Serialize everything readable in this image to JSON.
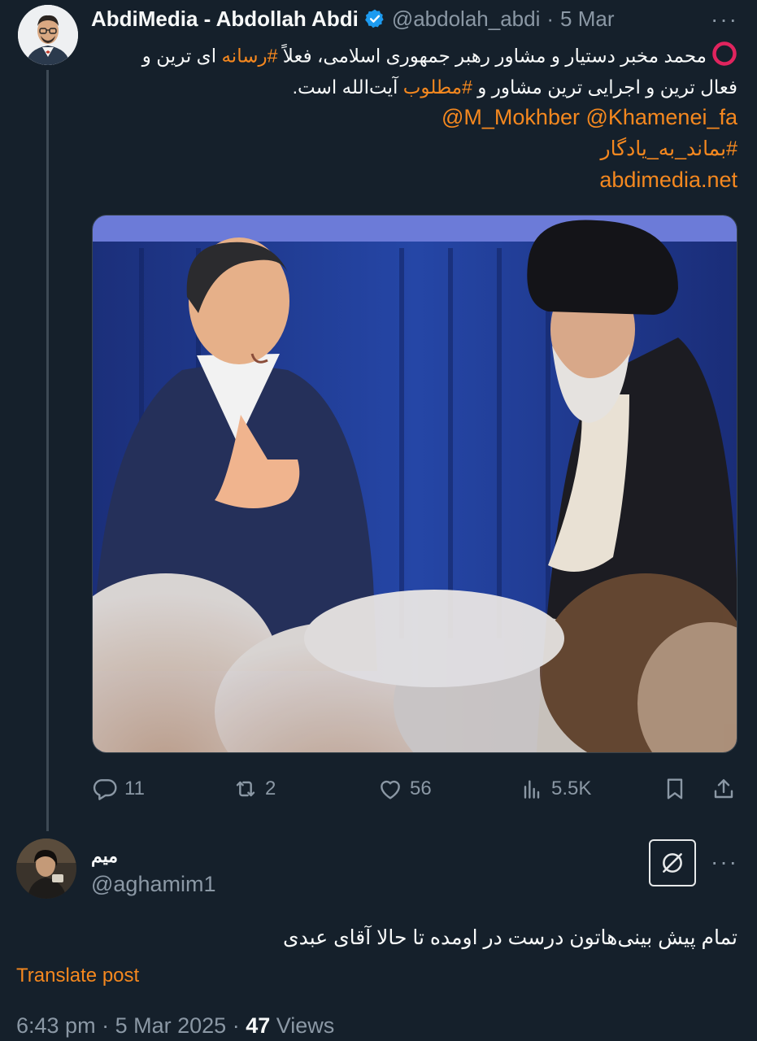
{
  "tweet": {
    "author_name": "AbdiMedia - Abdollah Abdi",
    "handle": "@abdolah_abdi",
    "date": "5 Mar",
    "line1_prefix": "محمد مخبر دستیار و مشاور رهبر جمهوری اسلامی، فعلاً ",
    "line1_tag": "#رسانه",
    "line1_suffix": " ای ترین و",
    "line2_prefix": "فعال ترین و اجرایی ترین مشاور و ",
    "line2_tag": "#مطلوب",
    "line2_suffix": " آیت‌الله است.",
    "mentions": "@M_Mokhber @Khamenei_fa",
    "hashtag": "#بماند_به_یادگار",
    "link": "abdimedia.net",
    "stats": {
      "replies": "11",
      "reposts": "2",
      "likes": "56",
      "views": "5.5K"
    }
  },
  "reply": {
    "author_name": "میم",
    "handle": "@aghamim1",
    "text": "تمام پیش بینی‌هاتون درست در اومده تا حالا آقای عبدی",
    "translate_label": "Translate post",
    "time": "6:43 pm",
    "full_date": "5 Mar 2025",
    "views_count": "47",
    "views_label": "Views"
  },
  "icons": {
    "verified": "verified-badge-icon",
    "record": "red-circle-icon",
    "reply": "reply-icon",
    "repost": "repost-icon",
    "like": "heart-icon",
    "views": "bar-chart-icon",
    "bookmark": "bookmark-icon",
    "share": "share-icon",
    "more": "more-icon",
    "grok": "grok-icon"
  },
  "colors": {
    "background": "#15202b",
    "accent": "#f5881f",
    "muted": "#8b98a5",
    "verified": "#1d9bf0",
    "record_red": "#e0245e"
  }
}
